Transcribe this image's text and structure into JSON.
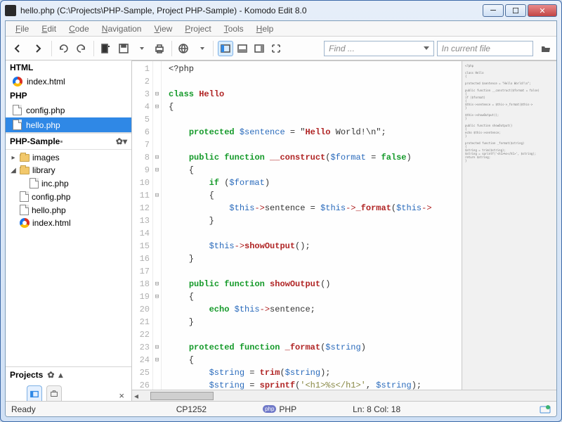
{
  "window": {
    "title": "hello.php (C:\\Projects\\PHP-Sample, Project PHP-Sample) - Komodo Edit 8.0"
  },
  "menu": [
    "File",
    "Edit",
    "Code",
    "Navigation",
    "View",
    "Project",
    "Tools",
    "Help"
  ],
  "find": {
    "placeholder": "Find ...",
    "scope": "In current file"
  },
  "sidebar": {
    "html_label": "HTML",
    "php_label": "PHP",
    "open": {
      "html": [
        {
          "name": "index.html",
          "icon": "chrome"
        }
      ],
      "php": [
        {
          "name": "config.php",
          "icon": "file"
        },
        {
          "name": "hello.php",
          "icon": "file"
        }
      ]
    },
    "project_name": "PHP-Sample",
    "tree": [
      {
        "kind": "folder",
        "name": "images",
        "open": false,
        "depth": 0
      },
      {
        "kind": "folder",
        "name": "library",
        "open": true,
        "depth": 0
      },
      {
        "kind": "file",
        "name": "inc.php",
        "icon": "file",
        "depth": 1
      },
      {
        "kind": "file",
        "name": "config.php",
        "icon": "file",
        "depth": 0
      },
      {
        "kind": "file",
        "name": "hello.php",
        "icon": "file",
        "depth": 0
      },
      {
        "kind": "file",
        "name": "index.html",
        "icon": "chrome",
        "depth": 0
      }
    ],
    "projects_label": "Projects"
  },
  "code": {
    "lines": [
      "<?php",
      "",
      "class Hello",
      "{",
      "",
      "    protected $sentence = \"Hello World!\\n\";",
      "",
      "    public function __construct($format = false)",
      "    {",
      "        if ($format)",
      "        {",
      "            $this->sentence = $this->_format($this->",
      "        }",
      "",
      "        $this->showOutput();",
      "    }",
      "",
      "    public function showOutput()",
      "    {",
      "        echo $this->sentence;",
      "    }",
      "",
      "    protected function _format($string)",
      "    {",
      "        $string = trim($string);",
      "        $string = sprintf('<h1>%s</h1>', $string);",
      "        return $string;",
      "    }"
    ]
  },
  "status": {
    "ready": "Ready",
    "encoding": "CP1252",
    "lang_icon": "php",
    "lang": "PHP",
    "position": "Ln: 8 Col: 18"
  }
}
